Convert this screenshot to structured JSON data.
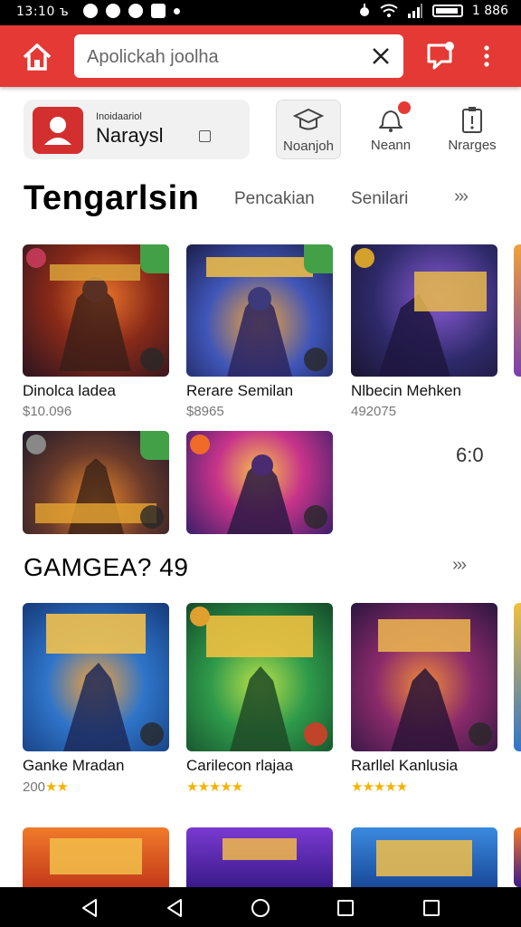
{
  "status_bar": {
    "time": "13:10 ъ",
    "battery": "1 886"
  },
  "search": {
    "placeholder": "Apolickah joolha"
  },
  "account": {
    "caption": "Inoidaariol",
    "name": "Naraysl"
  },
  "actions": [
    {
      "label": "Noanjoh",
      "icon": "graduation-cap-icon"
    },
    {
      "label": "Neann",
      "icon": "notification-icon"
    },
    {
      "label": "Nrarges",
      "icon": "clipboard-icon"
    }
  ],
  "section1": {
    "title": "Tengarlsin",
    "tabs": [
      "Pencakian",
      "Senilari"
    ],
    "more": "›››"
  },
  "section1_cards": [
    {
      "title": "Dinolca ladea",
      "sub": "$10.096"
    },
    {
      "title": "Rerare Semilan",
      "sub": "$8965"
    },
    {
      "title": "Nlbecin Mehken",
      "sub": "492075"
    }
  ],
  "section1_row2": {
    "counter": "6:0"
  },
  "section2": {
    "title": "GAMGEA? 49",
    "more": "›››"
  },
  "section2_cards": [
    {
      "title": "Ganke Mradan",
      "sub": "200",
      "stars": "★★"
    },
    {
      "title": "Carilecon rlajaa",
      "sub": "",
      "stars": "★★★★★"
    },
    {
      "title": "Rarllel Kanlusia",
      "sub": "",
      "stars": "★★★★★"
    }
  ],
  "colors": {
    "accent": "#e53935",
    "badge_green": "#43a047",
    "star": "#f5b301"
  }
}
